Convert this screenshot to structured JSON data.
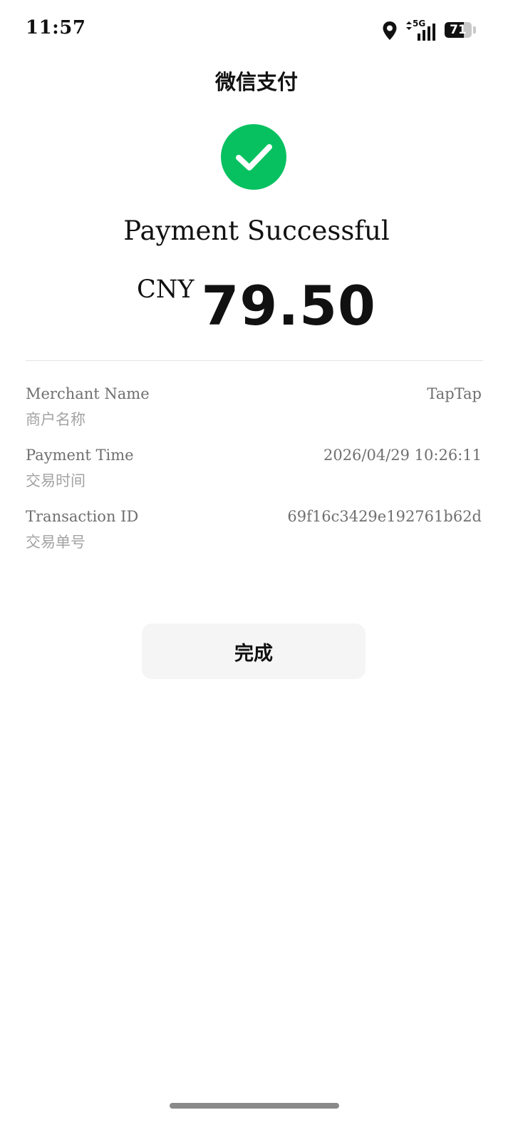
{
  "status_bar": {
    "time": "11:57",
    "network": "5G",
    "battery_level": 71,
    "battery_label": "71"
  },
  "header": {
    "title": "微信支付"
  },
  "result": {
    "icon": "check-circle-icon",
    "title": "Payment Successful",
    "currency": "CNY",
    "amount": "79.50"
  },
  "details": [
    {
      "label": "Merchant Name",
      "label_cn": "商户名称",
      "value": "TapTap"
    },
    {
      "label": "Payment Time",
      "label_cn": "交易时间",
      "value": "2026/04/29 10:26:11"
    },
    {
      "label": "Transaction ID",
      "label_cn": "交易单号",
      "value": "69f16c3429e192761b62d"
    }
  ],
  "actions": {
    "done_label": "完成"
  },
  "colors": {
    "success_green": "#07C160",
    "button_bg": "#F5F5F5",
    "label_gray": "#6F6F6F",
    "sublabel_gray": "#A3A3A3"
  }
}
